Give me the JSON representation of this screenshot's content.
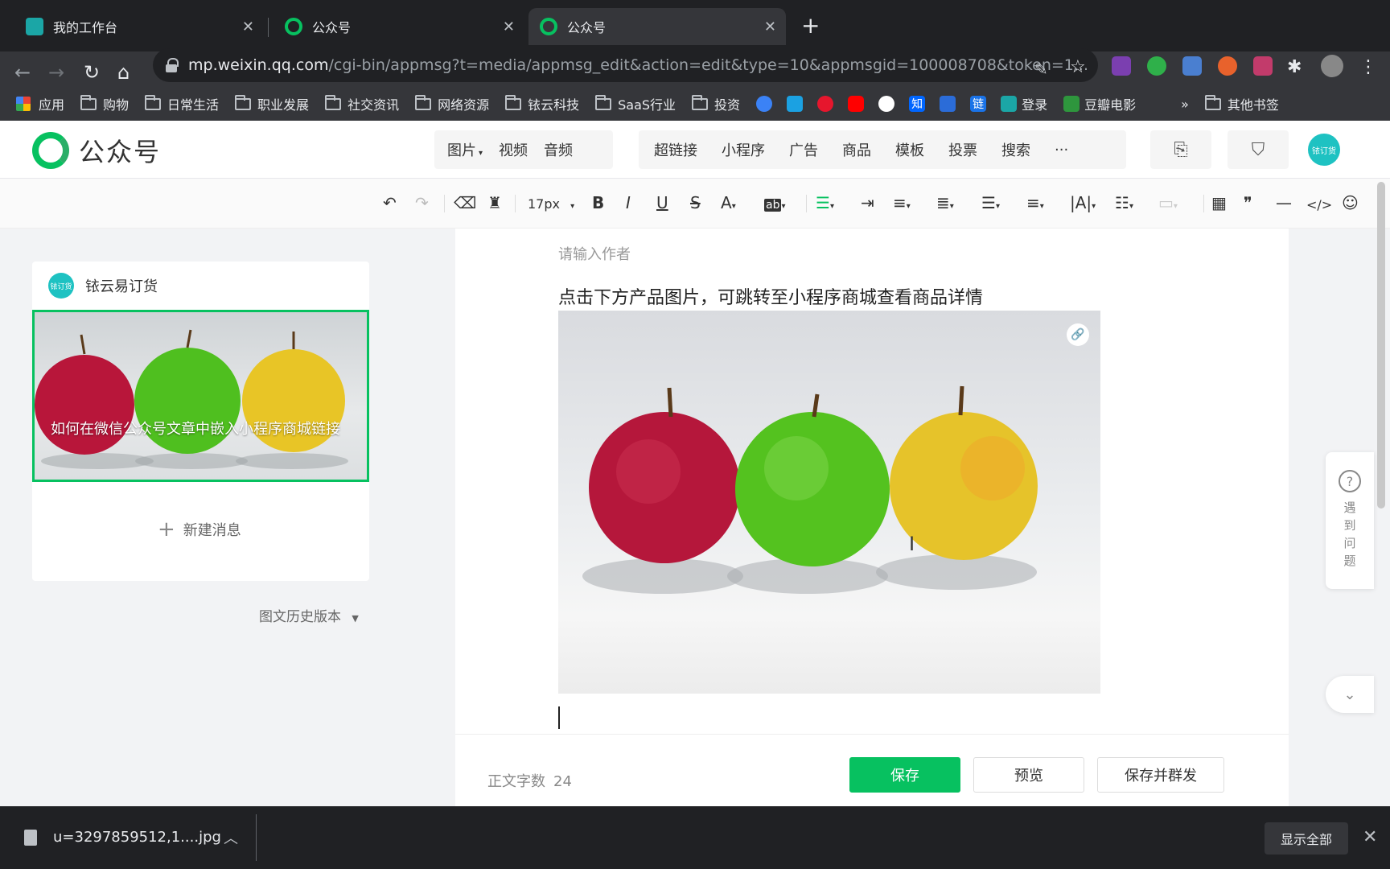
{
  "browser": {
    "tabs": [
      {
        "title": "我的工作台"
      },
      {
        "title": "公众号"
      },
      {
        "title": "公众号"
      }
    ],
    "url_host": "mp.weixin.qq.com",
    "url_path": "/cgi-bin/appmsg?t=media/appmsg_edit&action=edit&type=10&appmsgid=100008708&token=1...",
    "bookmarks": [
      "应用",
      "购物",
      "日常生活",
      "职业发展",
      "社交资讯",
      "网络资源",
      "铱云科技",
      "SaaS行业",
      "投资",
      "登录",
      "豆瓣电影"
    ],
    "bookmark_icon_names": [
      "bilibili-icon",
      "weibo-icon",
      "youtube-icon",
      "google-icon",
      "zhihu-icon"
    ],
    "bookmark_zhi": "知",
    "bookmark_lian": "链",
    "bookmarks_more": "»",
    "other_bookmarks": "其他书签"
  },
  "header": {
    "logo_text": "公众号",
    "media_menu": [
      "图片",
      "视频",
      "音频"
    ],
    "insert_menu": [
      "超链接",
      "小程序",
      "广告",
      "商品",
      "模板",
      "投票",
      "搜索",
      "···"
    ],
    "avatar_text": "铱订货"
  },
  "format_toolbar": {
    "font_size": "17px"
  },
  "left_panel": {
    "account_name": "铱云易订货",
    "account_avatar_text": "铱订货",
    "article_title": "如何在微信公众号文章中嵌入小程序商城链接",
    "new_message": "新建消息",
    "history": "图文历史版本"
  },
  "editor": {
    "author_placeholder": "请输入作者",
    "body_line": "点击下方产品图片，可跳转至小程序商城查看商品详情",
    "word_count_label": "正文字数",
    "word_count": "24",
    "save": "保存",
    "preview": "预览",
    "save_and_send": "保存并群发"
  },
  "help": {
    "text": "遇到问题"
  },
  "downloads": {
    "file_name": "u=3297859512,1....jpg",
    "show_all": "显示全部"
  },
  "colors": {
    "brand_green": "#07c160",
    "avatar_teal": "#1ec2c2"
  }
}
